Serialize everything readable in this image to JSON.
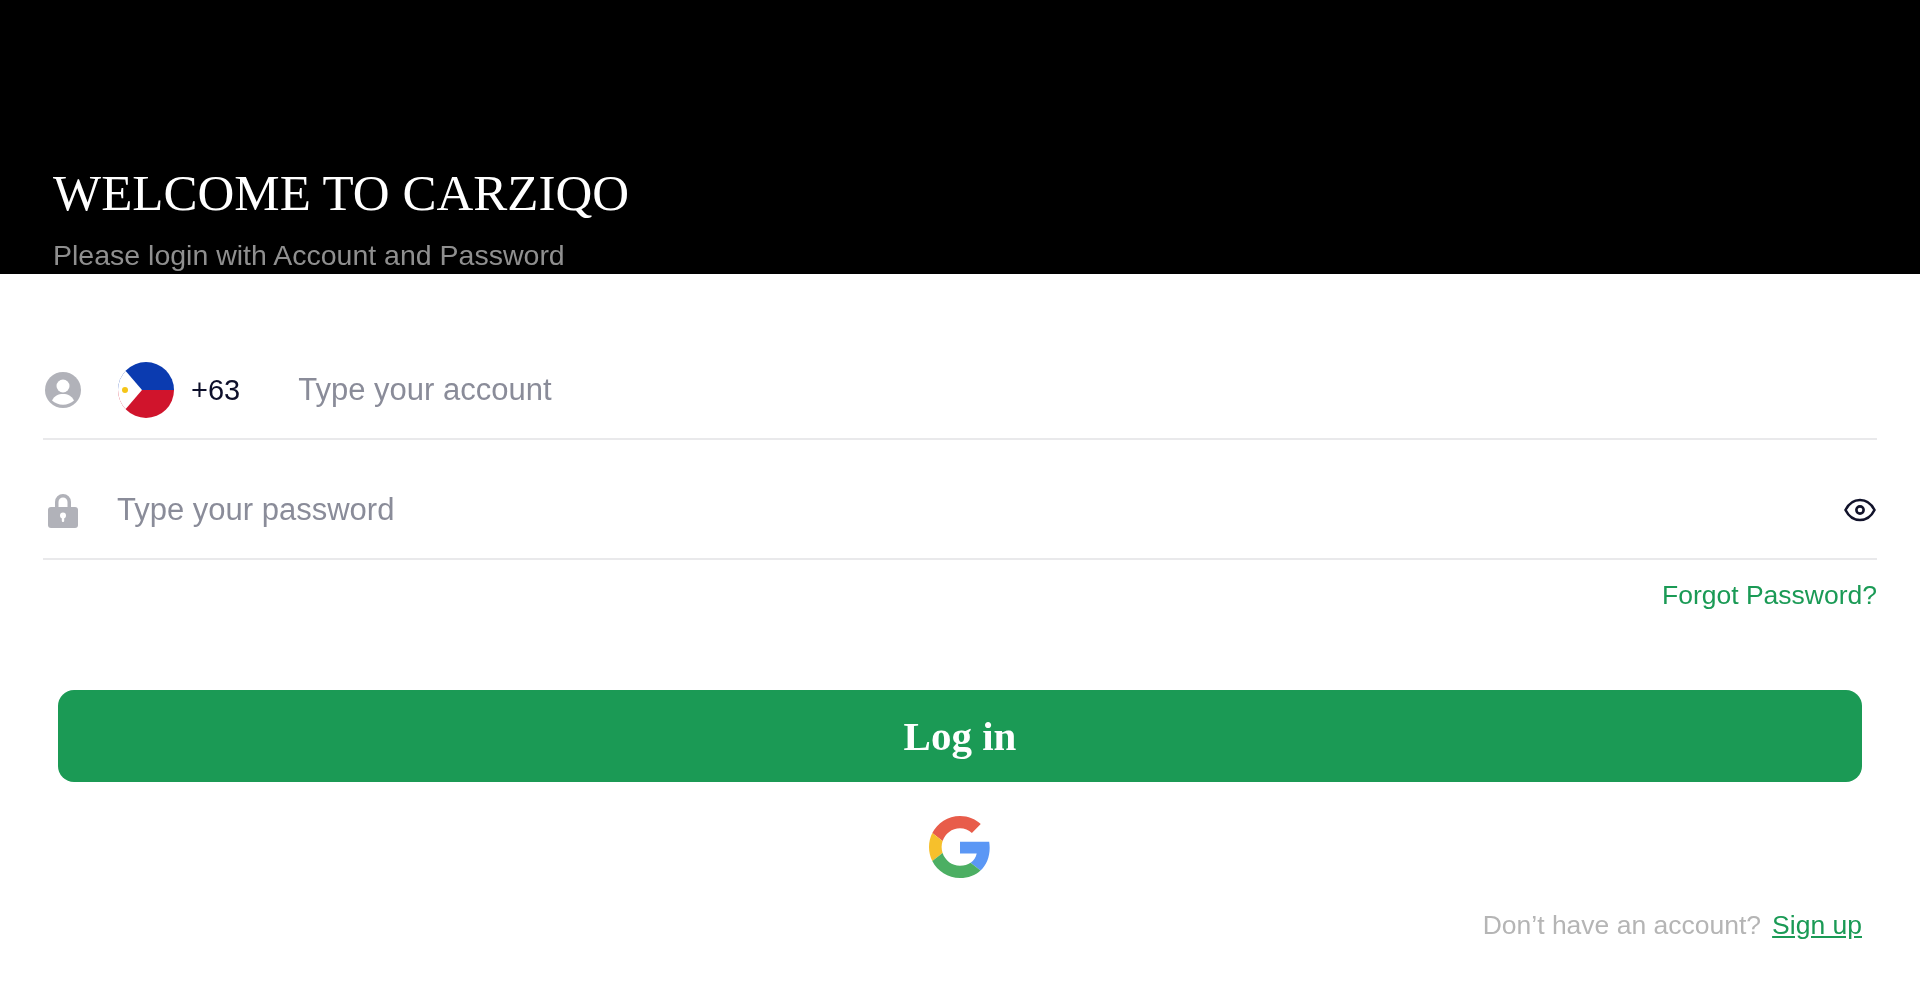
{
  "header": {
    "title": "WELCOME TO CARZIQO",
    "subtitle": "Please login with Account and Password"
  },
  "account_field": {
    "country_code": "+63",
    "placeholder": "Type your account"
  },
  "password_field": {
    "placeholder": "Type your password"
  },
  "forgot_password_link": "Forgot Password?",
  "login_button": "Log in",
  "signup_prompt": {
    "text": "Don’t have an account?",
    "link": "Sign up"
  }
}
